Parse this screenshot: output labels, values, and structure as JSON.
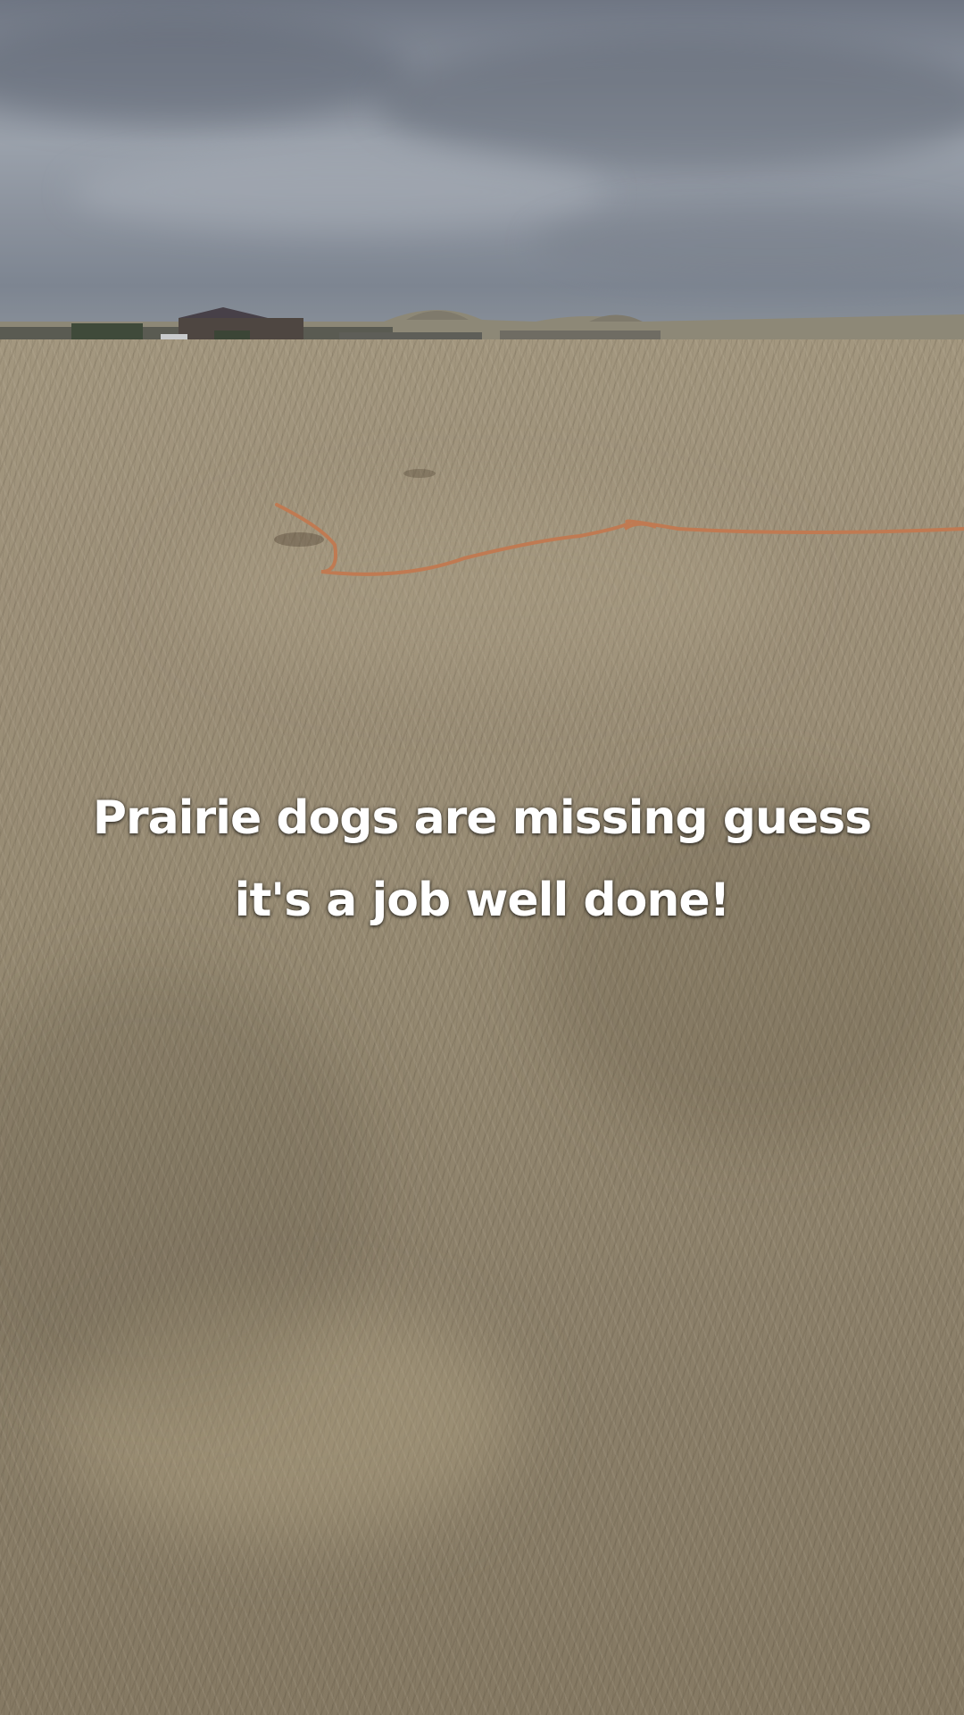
{
  "caption": {
    "line1": "Prairie dogs are missing guess",
    "line2": "it's a job well done!"
  },
  "colors": {
    "caption_text": "#ffffff",
    "sky": "#8a919c",
    "grass": "#968a72",
    "hose": "#c07a52"
  }
}
